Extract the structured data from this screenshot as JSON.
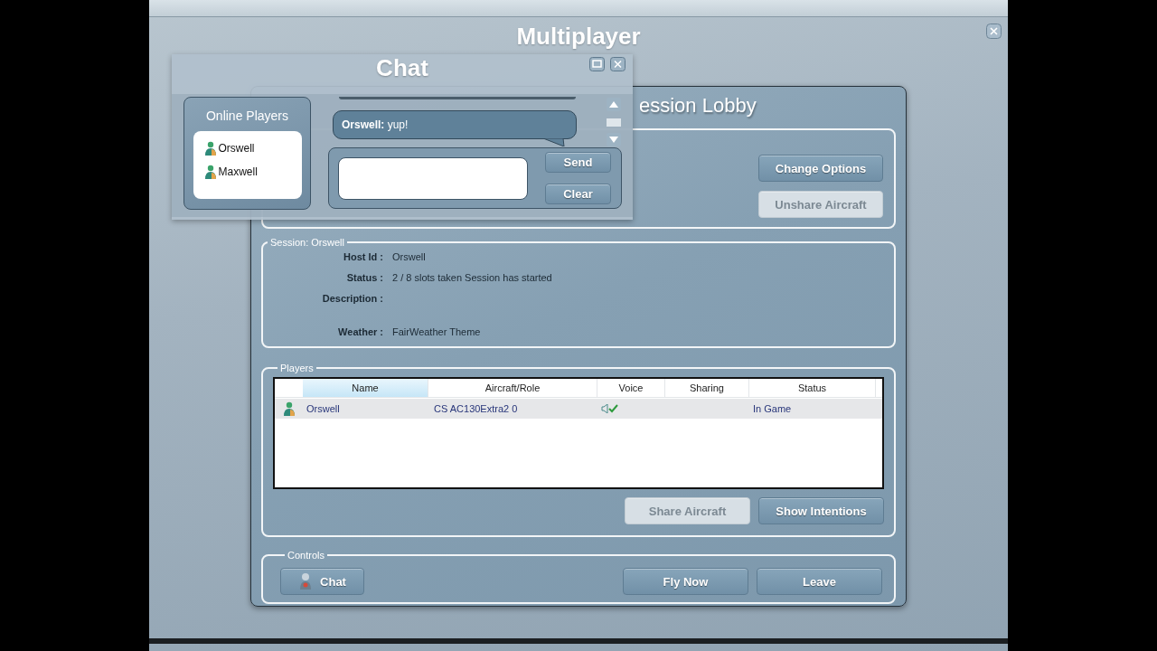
{
  "window": {
    "title": "Multiplayer"
  },
  "chat": {
    "title": "Chat",
    "online_players": {
      "title": "Online Players",
      "players": [
        {
          "name": "Orswell"
        },
        {
          "name": "Maxwell"
        }
      ]
    },
    "messages": [
      {
        "text": "**Orswell:** yup!"
      }
    ],
    "buttons": [
      {
        "label": "Send",
        "disabled": false
      },
      {
        "label": "Clear",
        "disabled": false
      }
    ]
  },
  "lobby": {
    "title": "ession Lobby",
    "options_buttons": [
      {
        "label": "Change Options",
        "disabled": false
      },
      {
        "label": "Unshare Aircraft",
        "disabled": true
      }
    ],
    "session": {
      "legend": "Session: Orswell",
      "fields": [
        {
          "label": "Host Id :",
          "value": "Orswell"
        },
        {
          "label": "Status :",
          "value": "2 / 8 slots taken Session has started"
        },
        {
          "label": "Description :"
        },
        {
          "label": "Weather :",
          "value": "FairWeather Theme"
        }
      ]
    },
    "players": {
      "legend": "Players",
      "columns": [
        {
          "label": "Name",
          "selected": true
        },
        {
          "label": "Aircraft/Role",
          "selected": false
        },
        {
          "label": "Voice",
          "selected": false
        },
        {
          "label": "Sharing",
          "selected": false
        },
        {
          "label": "Status",
          "selected": false
        }
      ],
      "rows": [
        {
          "name": "Orswell",
          "aircraft": "CS AC130Extra2 0",
          "voice": true,
          "status": "In Game",
          "selected": true
        }
      ],
      "buttons": [
        {
          "label": "Share Aircraft",
          "disabled": true
        },
        {
          "label": "Show Intentions",
          "disabled": false
        }
      ]
    },
    "controls": {
      "legend": "Controls",
      "buttons": [
        {
          "label": "Chat",
          "kind": "icon",
          "disabled": false
        },
        {
          "label": "Fly Now",
          "kind": "plain",
          "disabled": false
        },
        {
          "label": "Leave",
          "kind": "plain",
          "disabled": false
        }
      ]
    }
  }
}
